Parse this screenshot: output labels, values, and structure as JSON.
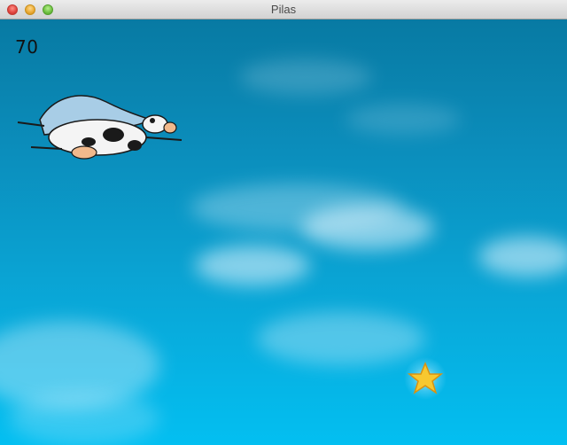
{
  "window": {
    "title": "Pilas"
  },
  "game": {
    "score": "70",
    "player": "flying-cow-icon",
    "collectible": "star-icon"
  },
  "colors": {
    "sky_top": "#087aa3",
    "sky_bottom": "#03bff1",
    "star": "#f7c830"
  }
}
